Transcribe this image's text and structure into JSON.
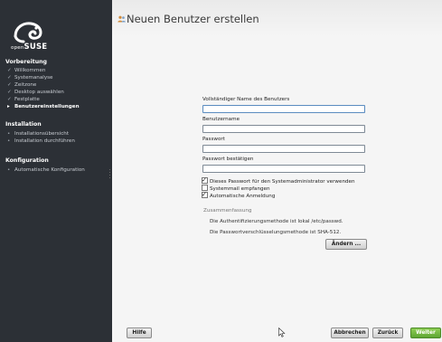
{
  "brand": {
    "logo_small": "open",
    "logo_main": "SUSE"
  },
  "sidebar": {
    "sections": [
      {
        "title": "Vorbereitung",
        "steps": [
          {
            "label": "Willkommen",
            "state": "done"
          },
          {
            "label": "Systemanalyse",
            "state": "done"
          },
          {
            "label": "Zeitzone",
            "state": "done"
          },
          {
            "label": "Desktop auswählen",
            "state": "done"
          },
          {
            "label": "Festplatte",
            "state": "done"
          },
          {
            "label": "Benutzereinstellungen",
            "state": "current"
          }
        ]
      },
      {
        "title": "Installation",
        "steps": [
          {
            "label": "Installationsübersicht",
            "state": "pending"
          },
          {
            "label": "Installation durchführen",
            "state": "pending"
          }
        ]
      },
      {
        "title": "Konfiguration",
        "steps": [
          {
            "label": "Automatische Konfiguration",
            "state": "pending"
          }
        ]
      }
    ]
  },
  "page": {
    "title": "Neuen Benutzer erstellen",
    "title_icon": "users-icon"
  },
  "form": {
    "fullname_label": "Vollständiger Name des Benutzers",
    "fullname_value": "",
    "username_label": "Benutzername",
    "username_value": "",
    "password_label": "Passwort",
    "password_value": "",
    "confirm_label": "Passwort bestätigen",
    "confirm_value": "",
    "options": [
      {
        "label": "Dieses Passwort für den Systemadministrator verwenden",
        "checked": true
      },
      {
        "label": "Systemmail empfangen",
        "checked": false
      },
      {
        "label": "Automatische Anmeldung",
        "checked": true
      }
    ]
  },
  "summary": {
    "label": "Zusammenfassung",
    "lines": [
      "Die Authentifizierungsmethode ist lokal /etc/passwd.",
      "Die Passwortverschlüsselungsmethode ist SHA-512."
    ],
    "change_button": "Ändern ..."
  },
  "footer": {
    "help": "Hilfe",
    "abort": "Abbrechen",
    "back": "Zurück",
    "next": "Weiter"
  },
  "colors": {
    "sidebar_bg": "#2c3036",
    "next_button": "#6fb33c",
    "focus_border": "#5b8cc0"
  }
}
